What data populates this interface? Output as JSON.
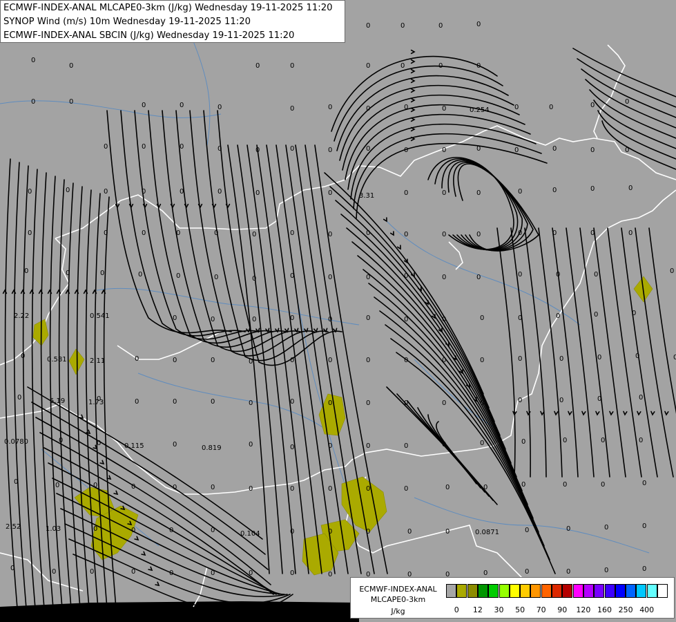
{
  "titles": [
    "ECMWF-INDEX-ANAL MLCAPE0-3km (J/kg) Wednesday 19-11-2025 11:20",
    "SYNOP Wind (m/s) 10m Wednesday 19-11-2025 11:20",
    "ECMWF-INDEX-ANAL SBCIN (J/kg) Wednesday 19-11-2025 11:20"
  ],
  "legend": {
    "title_line1": "ECMWF-INDEX-ANAL",
    "title_line2": "MLCAPE0-3km",
    "unit": "J/kg",
    "colors": [
      "#a6a6a6",
      "#aaaa00",
      "#8c8c00",
      "#009600",
      "#00cc00",
      "#96ff00",
      "#ffff00",
      "#ffcc00",
      "#ff9600",
      "#ff6400",
      "#dc2800",
      "#b40000",
      "#ff00ff",
      "#b400ff",
      "#7800ff",
      "#3c00ff",
      "#0000ff",
      "#0064ff",
      "#00c8ff",
      "#64ffff",
      "#ffffff"
    ],
    "tick_labels": [
      "0",
      "12",
      "30",
      "50",
      "70",
      "90",
      "120",
      "160",
      "250",
      "400"
    ]
  },
  "map_colors": {
    "background": "#a3a3a3",
    "border": "#ffffff",
    "river": "#5f8cbe",
    "streamline": "#000000",
    "cape_fill": "#aaaa00"
  },
  "value_labels": [
    "0",
    "0",
    "0",
    "0",
    "0",
    "0",
    "0",
    "0",
    "0",
    "0",
    "0",
    "0",
    "0",
    "0",
    "0",
    "0",
    "0",
    "0.254",
    "3.31",
    "2.22",
    "0.581",
    "0.541",
    "2.11",
    "5.19",
    "1.73",
    "0.0780",
    "0.115",
    "0.819",
    "2.52",
    "1.03",
    "0.104",
    "0.0871"
  ]
}
